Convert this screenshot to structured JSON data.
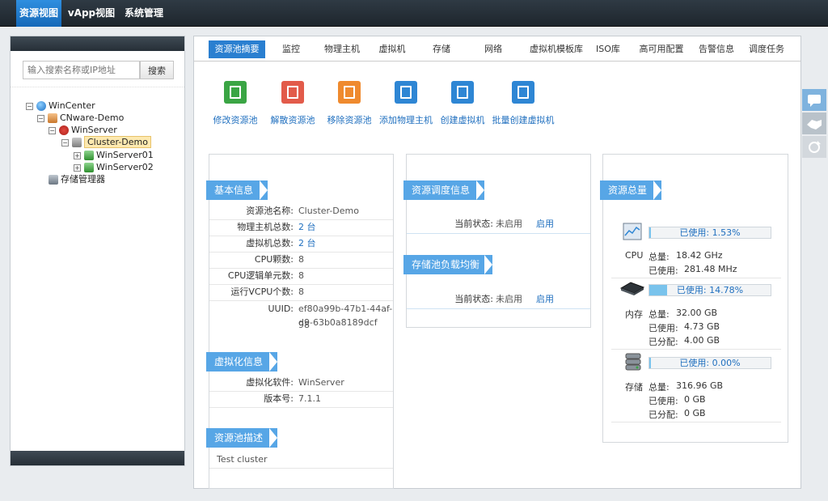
{
  "topnav": [
    {
      "label": "资源视图",
      "active": true
    },
    {
      "label": "vApp视图",
      "active": false
    },
    {
      "label": "系统管理",
      "active": false
    }
  ],
  "search": {
    "placeholder": "输入搜索名称或IP地址",
    "button": "搜索"
  },
  "tree": {
    "root": "WinCenter",
    "datacenter": "CNware-Demo",
    "server": "WinServer",
    "cluster": "Cluster-Demo",
    "host1": "WinServer01",
    "host2": "WinServer02",
    "storage_manager": "存储管理器"
  },
  "tabs": [
    {
      "label": "资源池摘要",
      "active": true
    },
    {
      "label": "监控"
    },
    {
      "label": "物理主机"
    },
    {
      "label": "虚拟机"
    },
    {
      "label": "存储"
    },
    {
      "label": "网络"
    },
    {
      "label": "虚拟机模板库"
    },
    {
      "label": "ISO库"
    },
    {
      "label": "高可用配置"
    },
    {
      "label": "告警信息"
    },
    {
      "label": "调度任务"
    }
  ],
  "actions": [
    {
      "label": "修改资源池",
      "color": "#3aa544"
    },
    {
      "label": "解散资源池",
      "color": "#e25b4a"
    },
    {
      "label": "移除资源池",
      "color": "#ef8a2e"
    },
    {
      "label": "添加物理主机",
      "color": "#2e86d4"
    },
    {
      "label": "创建虚拟机",
      "color": "#2e86d4"
    },
    {
      "label": "批量创建虚拟机",
      "color": "#2e86d4"
    }
  ],
  "basic": {
    "title": "基本信息",
    "name_k": "资源池名称:",
    "name_v": "Cluster-Demo",
    "hosts_k": "物理主机总数:",
    "hosts_v": "2 台",
    "vms_k": "虚拟机总数:",
    "vms_v": "2 台",
    "cpu_freq_k": "CPU颗数:",
    "cpu_freq_v": "8",
    "cpu_logic_k": "CPU逻辑单元数:",
    "cpu_logic_v": "8",
    "vcpu_k": "运行VCPU个数:",
    "vcpu_v": "8",
    "uuid_k": "UUID:",
    "uuid_v1": "ef80a99b-47b1-44af-98",
    "uuid_v2": "d9-63b0a8189dcf"
  },
  "virt": {
    "title": "虚拟化信息",
    "sw_k": "虚拟化软件:",
    "sw_v": "WinServer",
    "ver_k": "版本号:",
    "ver_v": "7.1.1"
  },
  "desc": {
    "title": "资源池描述",
    "text": "Test cluster"
  },
  "sched": {
    "title": "资源调度信息",
    "status_k": "当前状态:",
    "status_v": "未启用",
    "action": "启用"
  },
  "lb": {
    "title": "存储池负载均衡",
    "status_k": "当前状态:",
    "status_v": "未启用",
    "action": "启用"
  },
  "total": {
    "title": "资源总量",
    "cpu": {
      "label": "CPU",
      "used_pct": 1.53,
      "used_text": "已使用: 1.53%",
      "total_k": "总量:",
      "total_v": "18.42 GHz",
      "used_k": "已使用:",
      "used_v": "281.48 MHz"
    },
    "mem": {
      "label": "内存",
      "used_pct": 14.78,
      "used_text": "已使用: 14.78%",
      "total_k": "总量:",
      "total_v": "32.00 GB",
      "used_k": "已使用:",
      "used_v": "4.73 GB",
      "alloc_k": "已分配:",
      "alloc_v": "4.00 GB"
    },
    "storage": {
      "label": "存储",
      "used_pct": 0.0,
      "used_text": "已使用: 0.00%",
      "total_k": "总量:",
      "total_v": "316.96 GB",
      "used_k": "已使用:",
      "used_v": "0 GB",
      "alloc_k": "已分配:",
      "alloc_v": "0 GB"
    }
  },
  "colors": {
    "accent": "#2a7fd0",
    "ribbon": "#57a6e6",
    "link": "#1f6fbf"
  }
}
